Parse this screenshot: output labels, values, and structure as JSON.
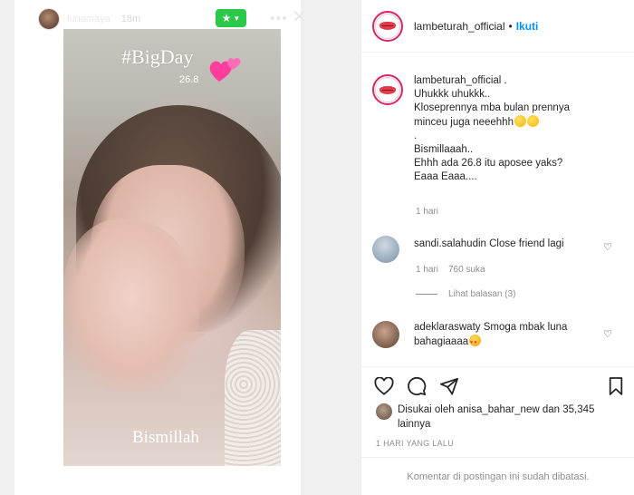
{
  "story": {
    "username": "lunamaya",
    "time": "18m",
    "hashtag": "#BigDay",
    "date": "26.8",
    "caption": "Bismillah"
  },
  "post": {
    "username": "lambeturah_official",
    "follow_label": "Ikuti",
    "caption": {
      "username": "lambeturah_official",
      "username_suffix": ".",
      "lines": [
        "Uhukkk uhukkk..",
        "Kloseprennya mba bulan prennya",
        "minceu juga neeehhh",
        ".",
        "Bismillaaah..",
        "Ehhh ada 26.8 itu aposee yaks?",
        "Eaaa Eaaa...."
      ],
      "time": "1 hari"
    },
    "comments": [
      {
        "username": "sandi.salahudin",
        "text": "Close friend lagi",
        "time": "1 hari",
        "likes": "760 suka",
        "replies_label": "Lihat balasan (3)"
      },
      {
        "username": "adeklaraswaty",
        "text": "Smoga mbak luna bahagiaaaa"
      }
    ],
    "liked_by": {
      "prefix": "Disukai oleh",
      "user": "anisa_bahar_new",
      "middle": "dan",
      "count": "35,345",
      "suffix": "lainnya"
    },
    "date": "1 HARI YANG LALU",
    "comments_disabled": "Komentar di postingan ini sudah dibatasi."
  },
  "colors": {
    "accent_blue": "#0095f6",
    "close_friends_green": "#2cc84a",
    "avatar_ring": "#d6266a"
  }
}
